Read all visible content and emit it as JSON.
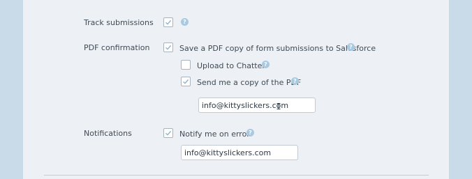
{
  "form": {
    "track_submissions": {
      "label": "Track submissions",
      "checked": true,
      "help_glyph": "?"
    },
    "pdf_confirmation": {
      "label": "PDF confirmation",
      "save_pdf": {
        "text": "Save a PDF copy of form submissions to Salesforce",
        "checked": true,
        "help_glyph": "?"
      },
      "upload_chatter": {
        "text": "Upload to Chatter",
        "checked": false,
        "help_glyph": "?"
      },
      "send_copy": {
        "text": "Send me a copy of the PDF",
        "checked": true,
        "help_glyph": "?"
      },
      "email_value": "info@kittyslickers.com"
    },
    "notifications": {
      "label": "Notifications",
      "notify_error": {
        "text": "Notify me on error",
        "checked": true,
        "help_glyph": "?"
      },
      "email_value": "info@kittyslickers.com"
    }
  },
  "colors": {
    "background": "#c9dbe8",
    "panel": "#edf1f5",
    "checkmark": "#8fb5cf",
    "help_icon": "#a8c9e2",
    "text": "#3f4a55"
  },
  "icons": {
    "check": "check-icon",
    "help": "help-icon",
    "cursor": "text-cursor-icon"
  }
}
